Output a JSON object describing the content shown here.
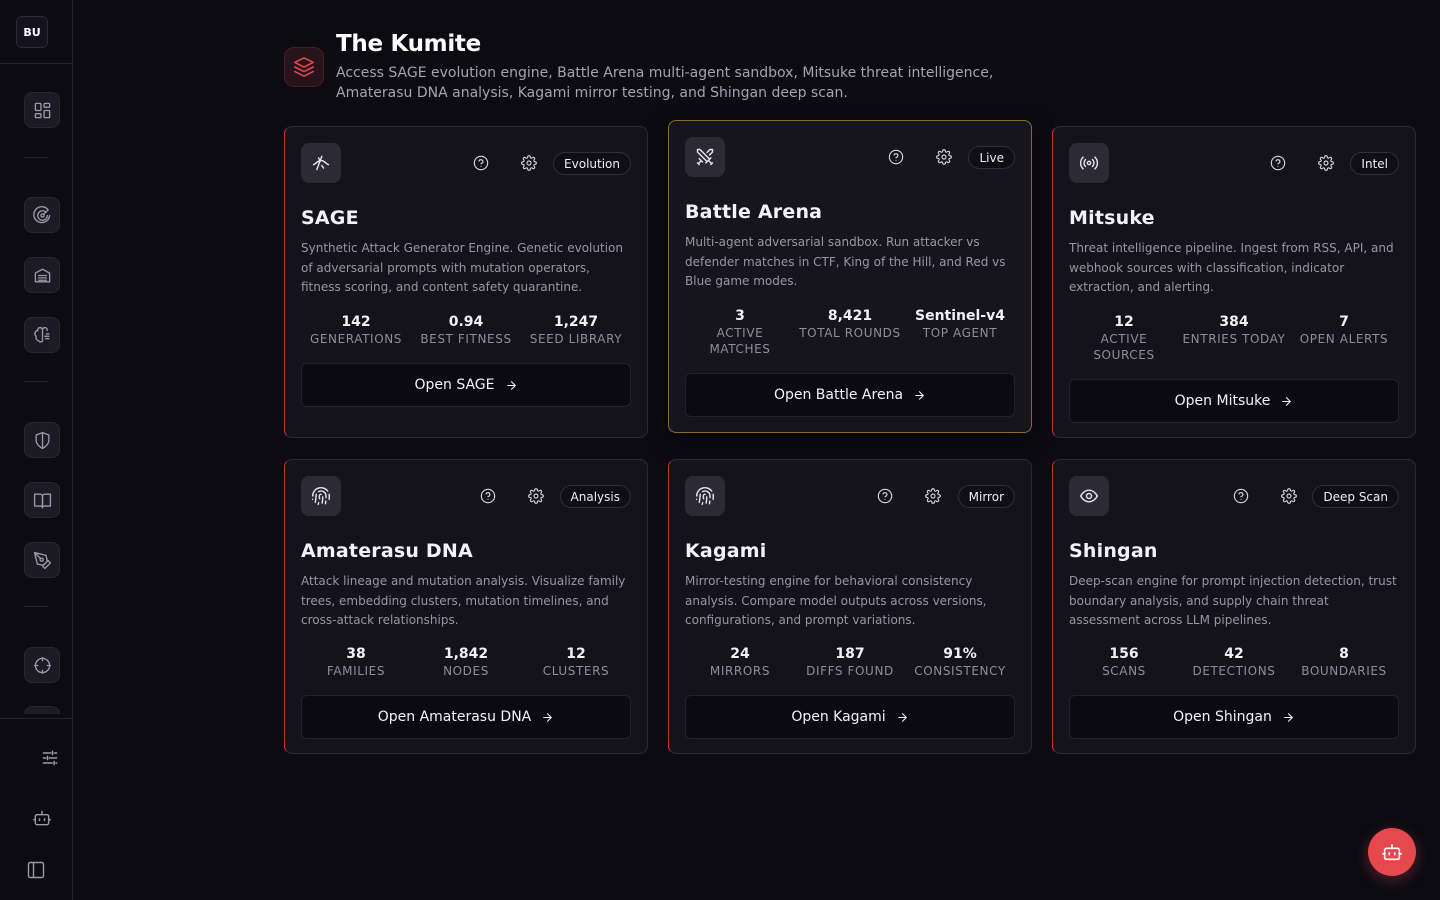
{
  "sidebar": {
    "avatar_initials": "BU",
    "nav_icons": [
      "dashboard-icon",
      "radar-icon",
      "archive-icon",
      "brain-icon",
      "shield-icon",
      "book-icon",
      "pen-tool-icon",
      "crosshair-icon"
    ],
    "footer_icons": [
      "sliders-icon",
      "bot-icon",
      "panel-toggle-icon"
    ]
  },
  "header": {
    "icon": "layers-icon",
    "title": "The Kumite",
    "subtitle": "Access SAGE evolution engine, Battle Arena multi-agent sandbox, Mitsuke threat intelligence, Amaterasu DNA analysis, Kagami mirror testing, and Shingan deep scan."
  },
  "colors": {
    "accent": "#e5484d",
    "background": "#0c0b12",
    "card_background": "#14131b",
    "highlight_border": "#8a6a2a"
  },
  "cards": [
    {
      "icon": "dna-icon",
      "badge": "Evolution",
      "title": "SAGE",
      "description": "Synthetic Attack Generator Engine. Genetic evolution of adversarial prompts with mutation operators, fitness scoring, and content safety quarantine.",
      "stats": [
        {
          "value": "142",
          "label": "GENERATIONS"
        },
        {
          "value": "0.94",
          "label": "BEST FITNESS"
        },
        {
          "value": "1,247",
          "label": "SEED LIBRARY"
        }
      ],
      "button": "Open SAGE"
    },
    {
      "icon": "swords-icon",
      "badge": "Live",
      "title": "Battle Arena",
      "description": "Multi-agent adversarial sandbox. Run attacker vs defender matches in CTF, King of the Hill, and Red vs Blue game modes.",
      "stats": [
        {
          "value": "3",
          "label": "ACTIVE MATCHES"
        },
        {
          "value": "8,421",
          "label": "TOTAL ROUNDS"
        },
        {
          "value": "Sentinel-v4",
          "label": "TOP AGENT"
        }
      ],
      "button": "Open Battle Arena"
    },
    {
      "icon": "radio-icon",
      "badge": "Intel",
      "title": "Mitsuke",
      "description": "Threat intelligence pipeline. Ingest from RSS, API, and webhook sources with classification, indicator extraction, and alerting.",
      "stats": [
        {
          "value": "12",
          "label": "ACTIVE SOURCES"
        },
        {
          "value": "384",
          "label": "ENTRIES TODAY"
        },
        {
          "value": "7",
          "label": "OPEN ALERTS"
        }
      ],
      "button": "Open Mitsuke"
    },
    {
      "icon": "fingerprint-icon",
      "badge": "Analysis",
      "title": "Amaterasu DNA",
      "description": "Attack lineage and mutation analysis. Visualize family trees, embedding clusters, mutation timelines, and cross-attack relationships.",
      "stats": [
        {
          "value": "38",
          "label": "FAMILIES"
        },
        {
          "value": "1,842",
          "label": "NODES"
        },
        {
          "value": "12",
          "label": "CLUSTERS"
        }
      ],
      "button": "Open Amaterasu DNA"
    },
    {
      "icon": "fingerprint-icon",
      "badge": "Mirror",
      "title": "Kagami",
      "description": "Mirror-testing engine for behavioral consistency analysis. Compare model outputs across versions, configurations, and prompt variations.",
      "stats": [
        {
          "value": "24",
          "label": "MIRRORS"
        },
        {
          "value": "187",
          "label": "DIFFS FOUND"
        },
        {
          "value": "91%",
          "label": "CONSISTENCY"
        }
      ],
      "button": "Open Kagami"
    },
    {
      "icon": "eye-icon",
      "badge": "Deep Scan",
      "title": "Shingan",
      "description": "Deep-scan engine for prompt injection detection, trust boundary analysis, and supply chain threat assessment across LLM pipelines.",
      "stats": [
        {
          "value": "156",
          "label": "SCANS"
        },
        {
          "value": "42",
          "label": "DETECTIONS"
        },
        {
          "value": "8",
          "label": "BOUNDARIES"
        }
      ],
      "button": "Open Shingan"
    }
  ],
  "fab": {
    "icon": "bot-icon"
  }
}
